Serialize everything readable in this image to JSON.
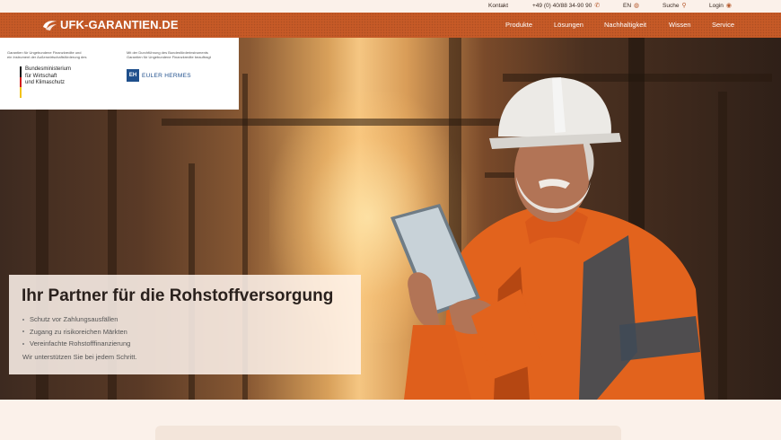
{
  "topbar": {
    "kontakt": "Kontakt",
    "phone": "+49 (0) 40/88 34-90 90",
    "language": "EN",
    "search": "Suche",
    "login": "Login"
  },
  "brand": {
    "logo_text": "UFK-GARANTIEN.DE"
  },
  "nav": {
    "items": [
      "Produkte",
      "Lösungen",
      "Nachhaltigkeit",
      "Wissen",
      "Service"
    ]
  },
  "partners": {
    "left_line1": "Garantien für Ungebundene Finanzkredite und",
    "left_line2": "ein Instrument der Außenwirtschaftsförderung des",
    "ministry_line1": "Bundesministerium",
    "ministry_line2": "für Wirtschaft",
    "ministry_line3": "und Klimaschutz",
    "right_line1": "Mit der Durchführung des Bundesförderinstruments",
    "right_line2": "Garantien für Ungebundene Finanzkredite beauftragt",
    "eh_logo": "EH",
    "eh_name": "EULER HERMES"
  },
  "hero": {
    "title": "Ihr Partner für die Rohstoffversorgung",
    "bullets": [
      "Schutz vor Zahlungsausfällen",
      "Zugang zu risikoreichen Märkten",
      "Vereinfachte Rohstofffinanzierung"
    ],
    "tagline": "Wir unterstützen Sie bei jedem Schritt."
  },
  "colors": {
    "brand_orange": "#c65a27",
    "page_bg": "#fbf1ea"
  }
}
